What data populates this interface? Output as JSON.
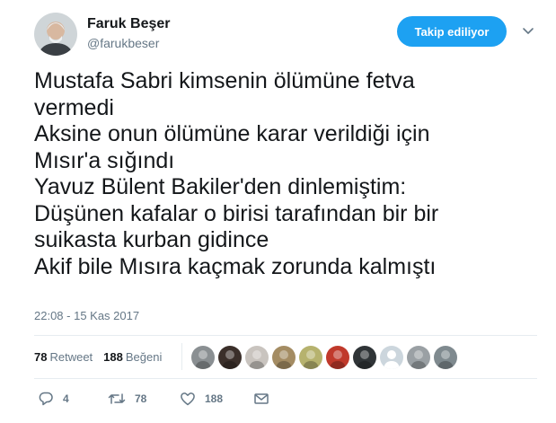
{
  "user": {
    "name": "Faruk Beşer",
    "handle": "@farukbeser"
  },
  "follow_button": {
    "label": "Takip ediliyor"
  },
  "tweet": {
    "lines": [
      "Mustafa Sabri kimsenin ölümüne fetva",
      "vermedi",
      "Aksine onun ölümüne karar verildiği için",
      "Mısır'a sığındı",
      "Yavuz Bülent Bakiler'den dinlemiştim:",
      "Düşünen kafalar o birisi tarafından bir bir",
      "suikasta kurban gidince",
      "Akif bile Mısıra kaçmak zorunda kalmıştı"
    ],
    "timestamp": "22:08 - 15 Kas 2017"
  },
  "stats": {
    "retweets_count": "78",
    "retweets_label": "Retweet",
    "likes_count": "188",
    "likes_label": "Beğeni"
  },
  "likers": [
    {
      "icon": "user-avatar",
      "color": "#8a8f92"
    },
    {
      "icon": "user-avatar",
      "color": "#3b2f2a"
    },
    {
      "icon": "user-avatar",
      "color": "#c9c4bf"
    },
    {
      "icon": "user-avatar",
      "color": "#a48c63"
    },
    {
      "icon": "user-avatar",
      "color": "#b6b26e"
    },
    {
      "icon": "user-avatar",
      "color": "#c0392b"
    },
    {
      "icon": "user-avatar",
      "color": "#2f3437"
    },
    {
      "icon": "default-avatar",
      "color": "#ccd6dd"
    },
    {
      "icon": "user-avatar",
      "color": "#9aa0a4"
    },
    {
      "icon": "user-avatar",
      "color": "#7f8a8f"
    }
  ],
  "actions": {
    "reply_count": "4",
    "retweet_count": "78",
    "like_count": "188"
  },
  "colors": {
    "accent": "#1da1f2",
    "text": "#14171a",
    "muted": "#657786",
    "divider": "#e6ecf0"
  }
}
